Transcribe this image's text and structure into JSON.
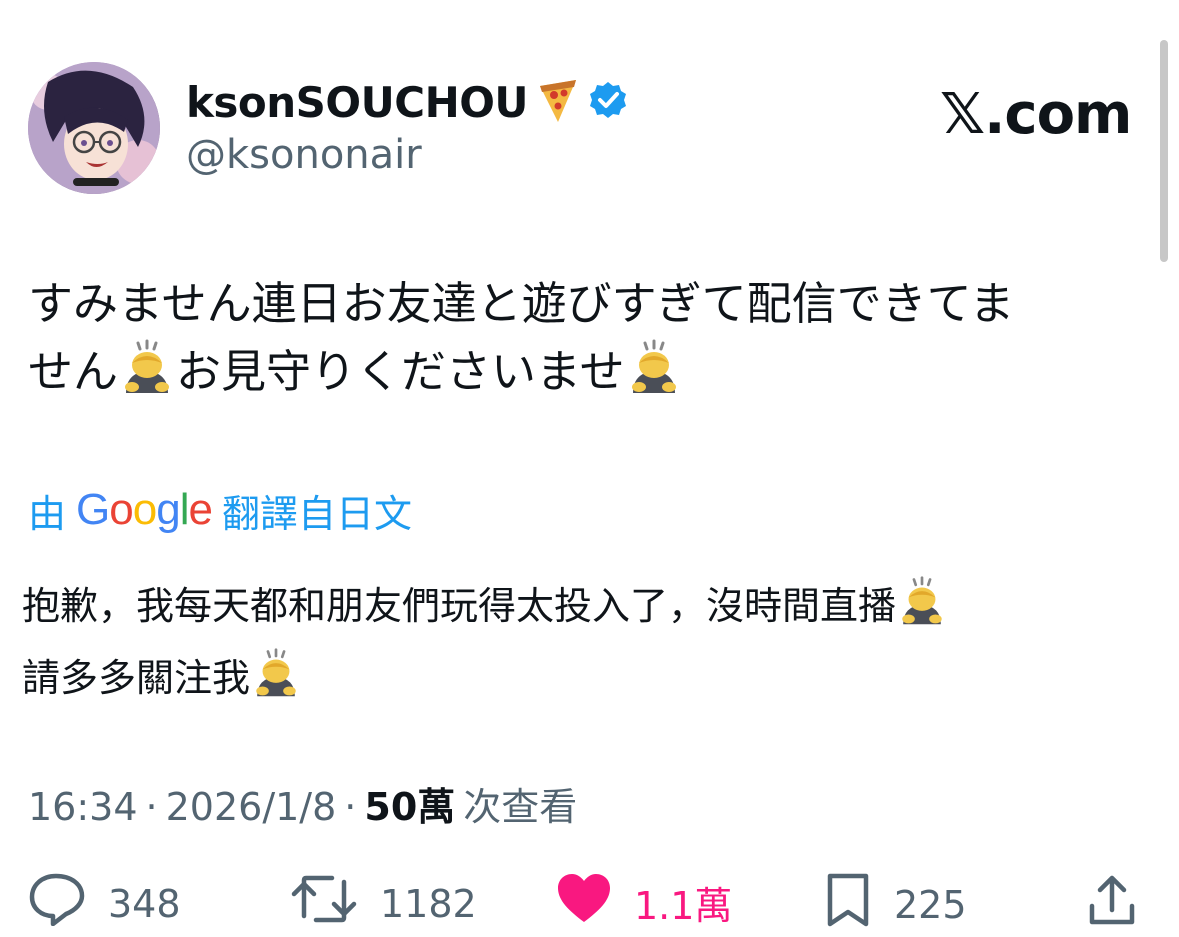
{
  "author": {
    "display_name": "ksonSOUCHOU",
    "handle": "@ksononair",
    "verified": true
  },
  "brand": "𝕏.com",
  "tweet": {
    "line1": "すみません連日お友達と遊びすぎて配信できてま",
    "line2_a": "せん",
    "line2_b": "お見守りくださいませ"
  },
  "translation": {
    "prefix": "由",
    "provider": "Google",
    "suffix": "翻譯自日文",
    "line1": "抱歉，我每天都和朋友們玩得太投入了，沒時間直播",
    "line2": "請多多關注我"
  },
  "meta": {
    "time": "16:34",
    "date": "2026/1/8",
    "views_count": "50萬",
    "views_label": "次查看",
    "separator": "·"
  },
  "actions": {
    "replies": "348",
    "reposts": "1182",
    "likes": "1.1萬",
    "bookmarks": "225"
  },
  "colors": {
    "accent": "#1d9bf0",
    "like": "#f91880",
    "muted": "#536471",
    "text": "#0f1419"
  }
}
